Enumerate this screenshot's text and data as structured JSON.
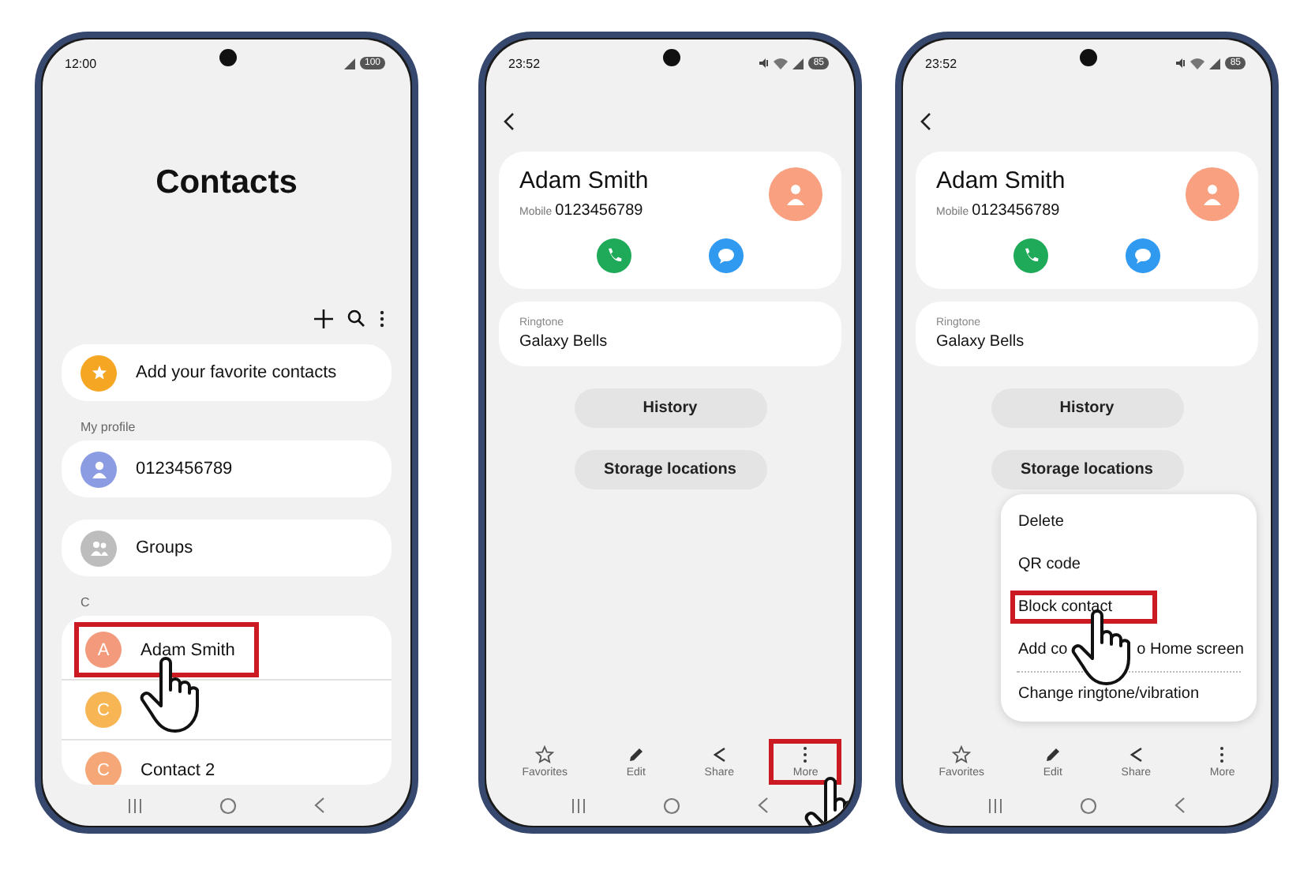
{
  "phones": [
    {
      "kind": "contacts",
      "status": {
        "time": "12:00",
        "battery": "100"
      },
      "title": "Contacts",
      "favorites": "Add your favorite contacts",
      "profile_header": "My profile",
      "profile": "0123456789",
      "groups": "Groups",
      "index_letter": "C",
      "contacts": [
        {
          "letter": "A",
          "name": "Adam Smith",
          "color": "#f39a7c",
          "highlighted": true
        },
        {
          "letter": "C",
          "color": "#f7b553",
          "highlighted": false
        },
        {
          "letter": "C",
          "name": "Contact 2",
          "color": "#f6a777",
          "highlighted": false
        }
      ]
    },
    {
      "kind": "details",
      "status": {
        "time": "23:52",
        "battery": "85"
      },
      "name": "Adam Smith",
      "number_label": "Mobile",
      "number": "0123456789",
      "ringtone_label": "Ringtone",
      "ringtone": "Galaxy Bells",
      "buttons": [
        "History",
        "Storage locations"
      ],
      "actions": [
        {
          "kind": "star",
          "label": "Favorites",
          "highlighted": false
        },
        {
          "kind": "edit",
          "label": "Edit",
          "highlighted": false
        },
        {
          "kind": "share",
          "label": "Share",
          "highlighted": false
        },
        {
          "kind": "more",
          "label": "More",
          "highlighted": true
        }
      ]
    },
    {
      "kind": "details",
      "status": {
        "time": "23:52",
        "battery": "85"
      },
      "name": "Adam Smith",
      "number_label": "Mobile",
      "number": "0123456789",
      "ringtone_label": "Ringtone",
      "ringtone": "Galaxy Bells",
      "buttons": [
        "History",
        "Storage locations"
      ],
      "actions": [
        {
          "kind": "star",
          "label": "Favorites",
          "highlighted": false
        },
        {
          "kind": "edit",
          "label": "Edit",
          "highlighted": false
        },
        {
          "kind": "share",
          "label": "Share",
          "highlighted": false
        },
        {
          "kind": "more",
          "label": "More",
          "highlighted": false
        }
      ],
      "menu": [
        {
          "label": "Delete",
          "highlighted": false
        },
        {
          "label": "QR code",
          "highlighted": false
        },
        {
          "label": "Block contact",
          "highlighted": true
        },
        {
          "label": "Add co",
          "label_end": "o Home screen",
          "highlighted": false
        },
        {
          "label": "Change ringtone/vibration",
          "highlighted": false,
          "separated": true
        }
      ]
    }
  ]
}
